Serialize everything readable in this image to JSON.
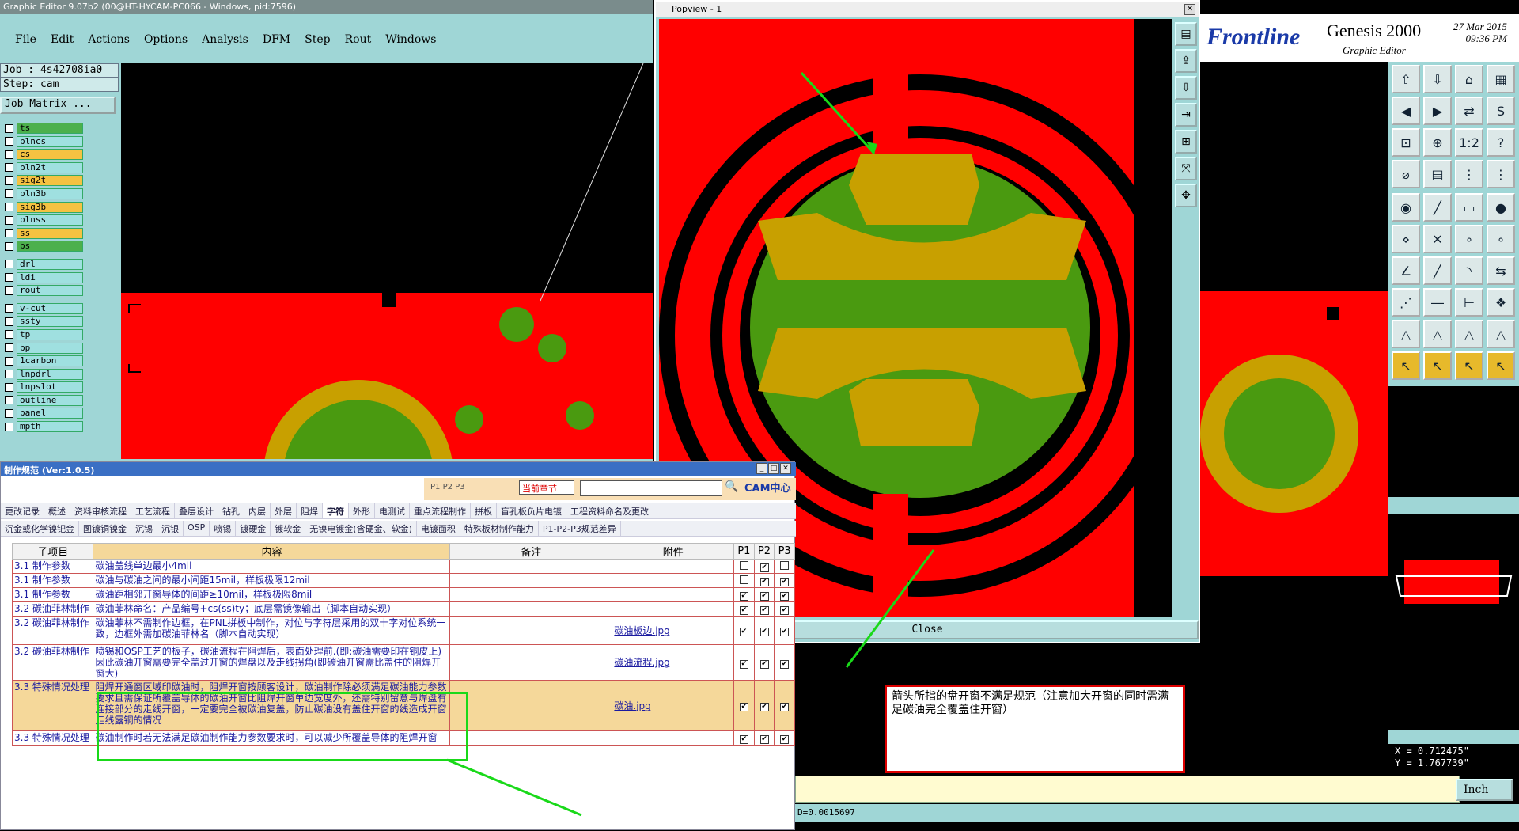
{
  "editor": {
    "title": "Graphic Editor 9.07b2 (00@HT-HYCAM-PC066 - Windows, pid:7596)",
    "menus": [
      "File",
      "Edit",
      "Actions",
      "Options",
      "Analysis",
      "DFM",
      "Step",
      "Rout",
      "Windows"
    ],
    "job_line": "Job : 4s42708ia0",
    "step_line": "Step: cam",
    "job_matrix": "Job Matrix ...",
    "layers": [
      {
        "name": "ts",
        "style": "green"
      },
      {
        "name": "plncs",
        "style": ""
      },
      {
        "name": "cs",
        "style": "orange"
      },
      {
        "name": "pln2t",
        "style": ""
      },
      {
        "name": "sig2t",
        "style": "orange"
      },
      {
        "name": "pln3b",
        "style": ""
      },
      {
        "name": "sig3b",
        "style": "orange"
      },
      {
        "name": "plnss",
        "style": ""
      },
      {
        "name": "ss",
        "style": "active"
      },
      {
        "name": "bs",
        "style": "green"
      },
      {
        "name": "drl",
        "style": ""
      },
      {
        "name": "ldi",
        "style": ""
      },
      {
        "name": "rout",
        "style": ""
      },
      {
        "name": "v-cut",
        "style": ""
      },
      {
        "name": "ssty",
        "style": ""
      },
      {
        "name": "tp",
        "style": ""
      },
      {
        "name": "bp",
        "style": ""
      },
      {
        "name": "1carbon",
        "style": ""
      },
      {
        "name": "lnpdrl",
        "style": ""
      },
      {
        "name": "lnpslot",
        "style": ""
      },
      {
        "name": "outline",
        "style": ""
      },
      {
        "name": "panel",
        "style": ""
      },
      {
        "name": "mpth",
        "style": ""
      }
    ]
  },
  "popview": {
    "title": "Popview - 1",
    "close_label": "Close"
  },
  "brand": {
    "logo": "Frontline",
    "product": "Genesis 2000",
    "subtitle": "Graphic Editor",
    "date": "27 Mar 2015",
    "time": "09:36 PM"
  },
  "coords": {
    "x": "X = 0.712475\"",
    "y": "Y = 1.767739\""
  },
  "unit": "Inch",
  "status": "D=0.0015697",
  "message": "箭头所指的盘开窗不满足规范（注意加大开窗的同时需满足碳油完全覆盖住开窗）",
  "spec": {
    "title": "制作规范 (Ver:1.0.5)",
    "p_options": "P1  P2  P3",
    "chapter_select": "当前章节",
    "cam_logo": "CAM中心",
    "tabs_row1": [
      "更改记录",
      "概述",
      "资料审核流程",
      "工艺流程",
      "叠层设计",
      "钻孔",
      "内层",
      "外层",
      "阻焊",
      "字符",
      "外形",
      "电测试",
      "重点流程制作",
      "拼板",
      "盲孔板负片电镀",
      "工程资料命名及更改"
    ],
    "tabs_row1_selected": "字符",
    "tabs_row2": [
      "沉金或化学镍钯金",
      "图镀铜镍金",
      "沉锡",
      "沉银",
      "OSP",
      "喷锡",
      "镀硬金",
      "镀软金",
      "无镍电镀金(含硬金、软金)",
      "电镀面积",
      "特殊板材制作能力",
      "P1-P2-P3规范差异"
    ],
    "columns": [
      "子项目",
      "内容",
      "备注",
      "附件",
      "P1",
      "P2",
      "P3"
    ],
    "rows": [
      {
        "sub": "3.1 制作参数",
        "content": "碳油盖线单边最小4mil",
        "note": "",
        "att": "",
        "p": [
          "☐",
          "☑",
          "☐"
        ]
      },
      {
        "sub": "3.1 制作参数",
        "content": "碳油与碳油之间的最小间距15mil，样板极限12mil",
        "note": "",
        "att": "",
        "p": [
          "☐",
          "☑",
          "☑"
        ]
      },
      {
        "sub": "3.1 制作参数",
        "content": "碳油距相邻开窗导体的间距≥10mil，样板极限8mil",
        "note": "",
        "att": "",
        "p": [
          "☑",
          "☑",
          "☑"
        ]
      },
      {
        "sub": "3.2 碳油菲林制作",
        "content": "碳油菲林命名：产品编号+cs(ss)ty；底层需镜像输出（脚本自动实现）",
        "note": "",
        "att": "",
        "p": [
          "☑",
          "☑",
          "☑"
        ]
      },
      {
        "sub": "3.2 碳油菲林制作",
        "content": "碳油菲林不需制作边框，在PNL拼板中制作，对位与字符层采用的双十字对位系统一致，边框外需加碳油菲林名（脚本自动实现）",
        "note": "",
        "att": "碳油板边.jpg",
        "p": [
          "☑",
          "☑",
          "☑"
        ]
      },
      {
        "sub": "3.2 碳油菲林制作",
        "content": "喷锡和OSP工艺的板子，碳油流程在阻焊后，表面处理前.(即:碳油需要印在铜皮上)因此碳油开窗需要完全盖过开窗的焊盘以及走线拐角(即碳油开窗需比盖住的阻焊开窗大)",
        "note": "",
        "att": "碳油流程.jpg",
        "p": [
          "☑",
          "☑",
          "☑"
        ]
      },
      {
        "sub": "3.3 特殊情况处理",
        "content": "阻焊开通窗区域印碳油时，阻焊开窗按顾客设计，碳油制作除必须满足碳油能力参数要求且需保证所覆盖导体的碳油开窗比阻焊开窗单边宽度外，还需特别留意与焊盘有连接部分的走线开窗，一定要完全被碳油复盖，防止碳油没有盖住开窗的线造成开窗走线露铜的情况",
        "note": "",
        "att": "碳油.jpg",
        "p": [
          "☑",
          "☑",
          "☑"
        ],
        "highlight": true
      },
      {
        "sub": "3.3 特殊情况处理",
        "content": "碳油制作时若无法满足碳油制作能力参数要求时，可以减少所覆盖导体的阻焊开窗",
        "note": "",
        "att": "",
        "p": [
          "☑",
          "☑",
          "☑"
        ]
      }
    ]
  },
  "colors": {
    "teal": "#9fd6d6",
    "red": "#ff0000",
    "green": "#4a9a10",
    "gold": "#c8a000",
    "highlight": "#19d919"
  },
  "icons": [
    "close-icon",
    "maximize-icon",
    "minimize-icon",
    "search-icon",
    "arrow-icon"
  ]
}
